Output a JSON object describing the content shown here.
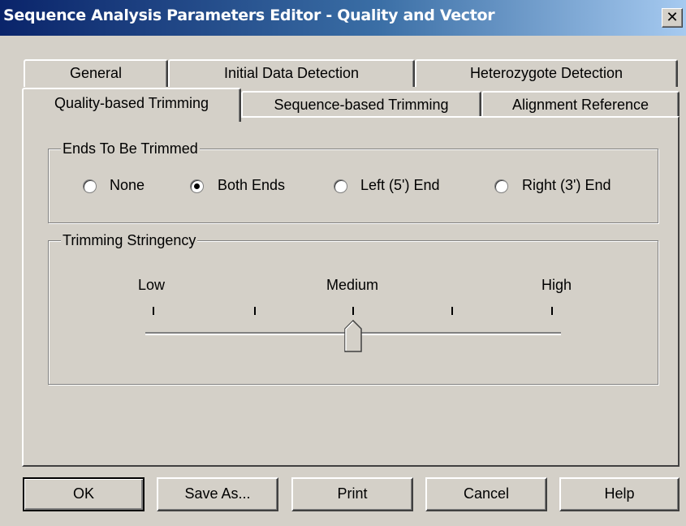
{
  "window": {
    "title": "Sequence Analysis Parameters Editor - Quality and Vector",
    "close_glyph": "✕"
  },
  "tabs": {
    "row1": [
      "General",
      "Initial Data Detection",
      "Heterozygote Detection"
    ],
    "row2": [
      "Quality-based Trimming",
      "Sequence-based Trimming",
      "Alignment Reference"
    ],
    "active": "Quality-based Trimming"
  },
  "ends_group": {
    "legend": "Ends To Be Trimmed",
    "options": [
      "None",
      "Both Ends",
      "Left (5') End",
      "Right (3') End"
    ],
    "selected": "Both Ends"
  },
  "stringency_group": {
    "legend": "Trimming Stringency",
    "labels": {
      "low": "Low",
      "medium": "Medium",
      "high": "High"
    },
    "tick_count": 5,
    "value_fraction": 0.5
  },
  "buttons": {
    "ok": "OK",
    "save_as": "Save As...",
    "print": "Print",
    "cancel": "Cancel",
    "help": "Help"
  }
}
